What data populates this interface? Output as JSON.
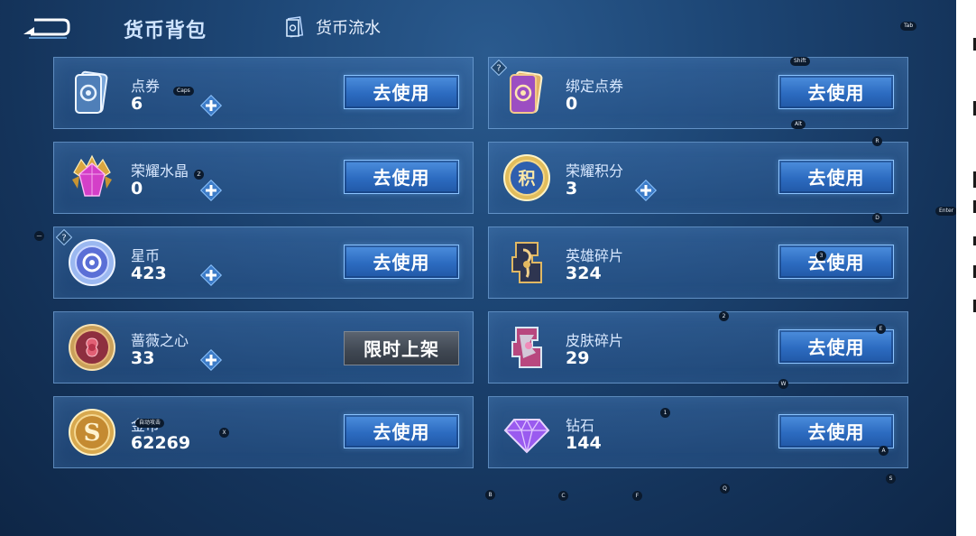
{
  "header": {
    "title": "货币背包",
    "flow_link": "货币流水"
  },
  "use_label": "去使用",
  "limited_label": "限时上架",
  "currencies_left": [
    {
      "name": "点券",
      "amount": "6"
    },
    {
      "name": "荣耀水晶",
      "amount": "0"
    },
    {
      "name": "星币",
      "amount": "423"
    },
    {
      "name": "蔷薇之心",
      "amount": "33"
    },
    {
      "name": "金币",
      "amount": "62269"
    }
  ],
  "currencies_right": [
    {
      "name": "绑定点券",
      "amount": "0"
    },
    {
      "name": "荣耀积分",
      "amount": "3"
    },
    {
      "name": "英雄碎片",
      "amount": "324"
    },
    {
      "name": "皮肤碎片",
      "amount": "29"
    },
    {
      "name": "钻石",
      "amount": "144"
    }
  ],
  "key_hints": {
    "tab": "Tab",
    "shift": "Shift",
    "caps": "Caps",
    "alt": "Alt",
    "enter": "Enter",
    "r": "R",
    "d": "D",
    "e": "E",
    "w": "W",
    "a": "A",
    "s": "S",
    "q": "Q",
    "b": "B",
    "c": "C",
    "f": "F",
    "x": "X",
    "z": "Z",
    "one": "1",
    "two": "2",
    "three": "3",
    "minus": "—",
    "aim": "自动攻击"
  },
  "colors": {
    "use_button": "#2c6bc0",
    "limited_button": "#3f4752",
    "card_border": "#8cbef0"
  }
}
